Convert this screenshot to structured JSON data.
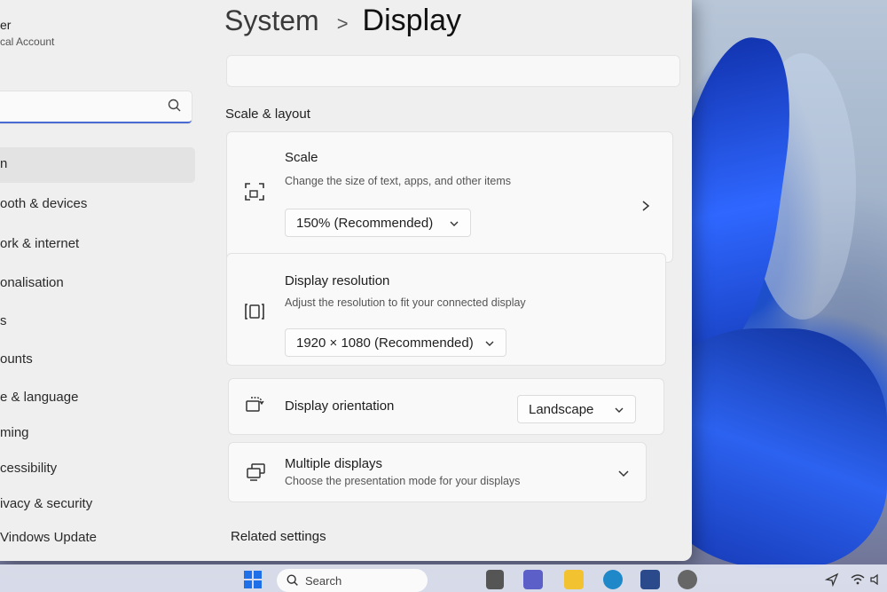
{
  "user": {
    "name": "er",
    "account": "cal Account"
  },
  "search": {
    "placeholder": "g"
  },
  "sidebar": {
    "items": [
      {
        "label": "n"
      },
      {
        "label": "ooth & devices"
      },
      {
        "label": "ork & internet"
      },
      {
        "label": "onalisation"
      },
      {
        "label": "s"
      },
      {
        "label": "ounts"
      },
      {
        "label": "e & language"
      },
      {
        "label": "ming"
      },
      {
        "label": "cessibility"
      },
      {
        "label": "ivacy & security"
      },
      {
        "label": "Vindows Update"
      }
    ]
  },
  "breadcrumb": {
    "parent": "System",
    "separator": ">",
    "current": "Display"
  },
  "sections": {
    "scale_layout": "Scale & layout",
    "related": "Related settings"
  },
  "cards": {
    "scale": {
      "title": "Scale",
      "description": "Change the size of text, apps, and other items",
      "value": "150% (Recommended)",
      "icon": "scale-icon"
    },
    "resolution": {
      "title": "Display resolution",
      "description": "Adjust the resolution to fit your connected display",
      "value": "1920 × 1080 (Recommended)",
      "icon": "resolution-icon"
    },
    "orientation": {
      "title": "Display orientation",
      "value": "Landscape",
      "icon": "orientation-icon"
    },
    "multiple": {
      "title": "Multiple displays",
      "description": "Choose the presentation mode for your displays",
      "icon": "multiple-displays-icon"
    }
  },
  "taskbar": {
    "search_label": "Search"
  },
  "colors": {
    "accent": "#4a6bd1",
    "window_bg": "#efefef",
    "card_bg": "#f9f9f9"
  }
}
